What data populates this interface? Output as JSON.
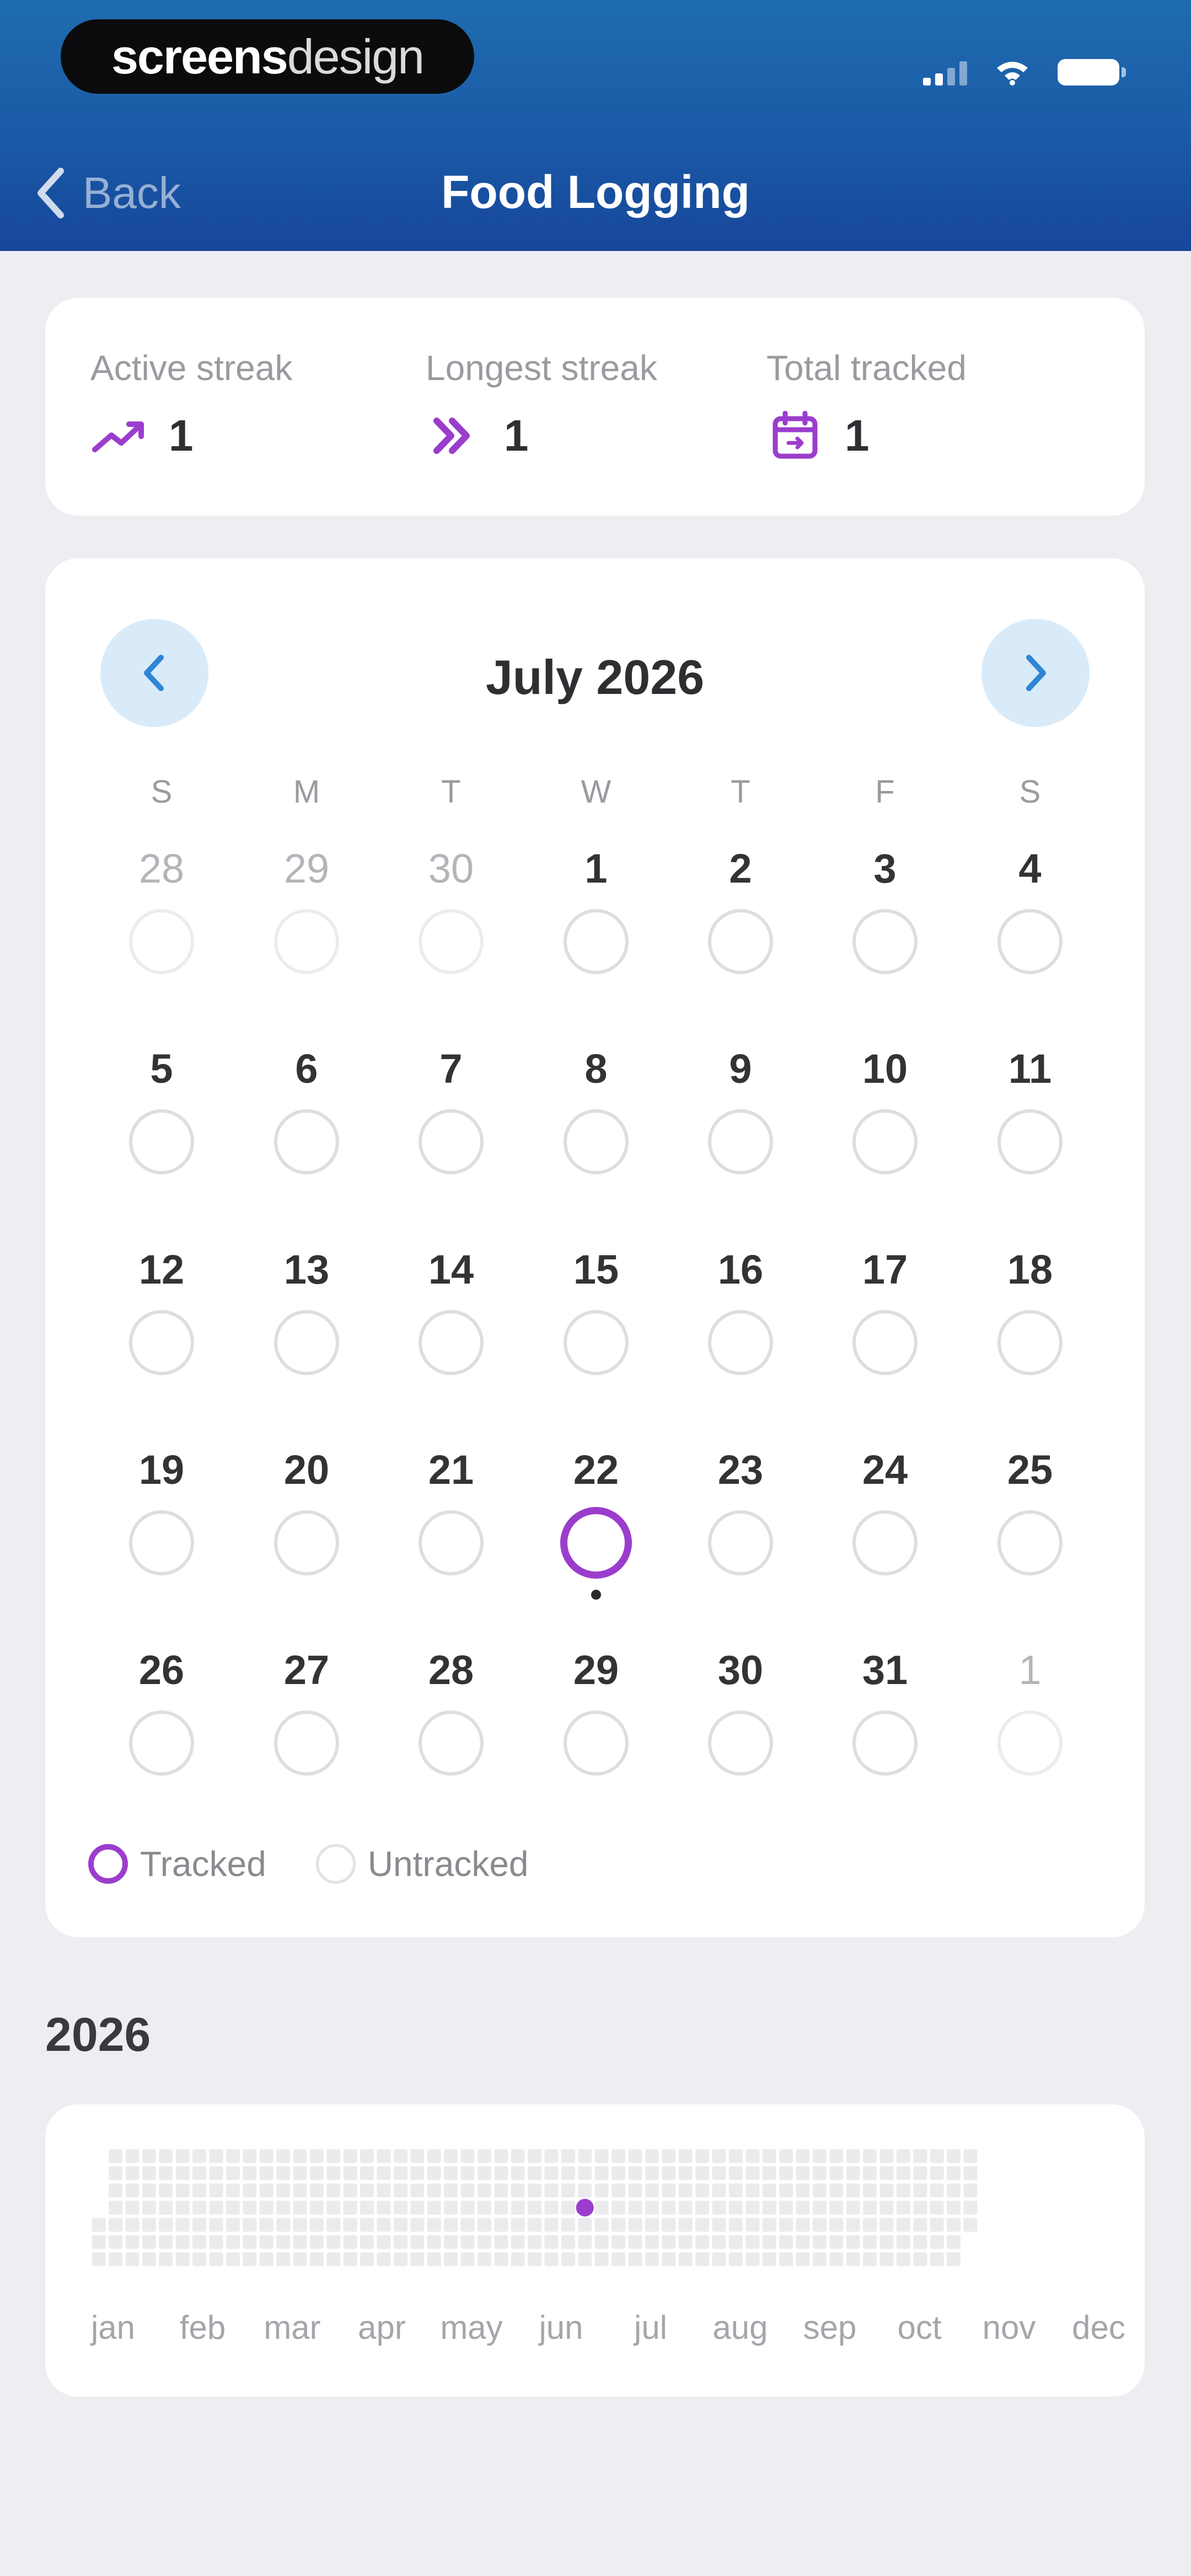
{
  "status_bar": {
    "brand_bold": "screens",
    "brand_light": "design"
  },
  "nav": {
    "back_label": "Back",
    "title": "Food Logging"
  },
  "stats": [
    {
      "label": "Active streak",
      "value": "1",
      "icon": "trend-up-icon"
    },
    {
      "label": "Longest streak",
      "value": "1",
      "icon": "double-chevron-icon"
    },
    {
      "label": "Total tracked",
      "value": "1",
      "icon": "calendar-icon"
    }
  ],
  "calendar": {
    "month_title": "July 2026",
    "weekdays": [
      "S",
      "M",
      "T",
      "W",
      "T",
      "F",
      "S"
    ],
    "weeks": [
      [
        {
          "d": "28",
          "other": true
        },
        {
          "d": "29",
          "other": true
        },
        {
          "d": "30",
          "other": true
        },
        {
          "d": "1"
        },
        {
          "d": "2"
        },
        {
          "d": "3"
        },
        {
          "d": "4"
        }
      ],
      [
        {
          "d": "5"
        },
        {
          "d": "6"
        },
        {
          "d": "7"
        },
        {
          "d": "8"
        },
        {
          "d": "9"
        },
        {
          "d": "10"
        },
        {
          "d": "11"
        }
      ],
      [
        {
          "d": "12"
        },
        {
          "d": "13"
        },
        {
          "d": "14"
        },
        {
          "d": "15"
        },
        {
          "d": "16"
        },
        {
          "d": "17"
        },
        {
          "d": "18"
        }
      ],
      [
        {
          "d": "19"
        },
        {
          "d": "20"
        },
        {
          "d": "21"
        },
        {
          "d": "22",
          "tracked": true,
          "today": true
        },
        {
          "d": "23"
        },
        {
          "d": "24"
        },
        {
          "d": "25"
        }
      ],
      [
        {
          "d": "26"
        },
        {
          "d": "27"
        },
        {
          "d": "28"
        },
        {
          "d": "29"
        },
        {
          "d": "30"
        },
        {
          "d": "31"
        },
        {
          "d": "1",
          "other": true
        }
      ]
    ],
    "legend": {
      "tracked": "Tracked",
      "untracked": "Untracked"
    }
  },
  "year": {
    "title": "2026",
    "months": [
      "jan",
      "feb",
      "mar",
      "apr",
      "may",
      "jun",
      "jul",
      "aug",
      "sep",
      "oct",
      "nov",
      "dec"
    ],
    "tracked_dates": [
      "2026-07-22"
    ]
  },
  "colors": {
    "accent": "#9b3dcc",
    "header_top": "#1f6cb0",
    "header_bottom": "#17469a",
    "nav_button_bg": "#d9ebf9",
    "nav_arrow": "#2f86d4"
  }
}
